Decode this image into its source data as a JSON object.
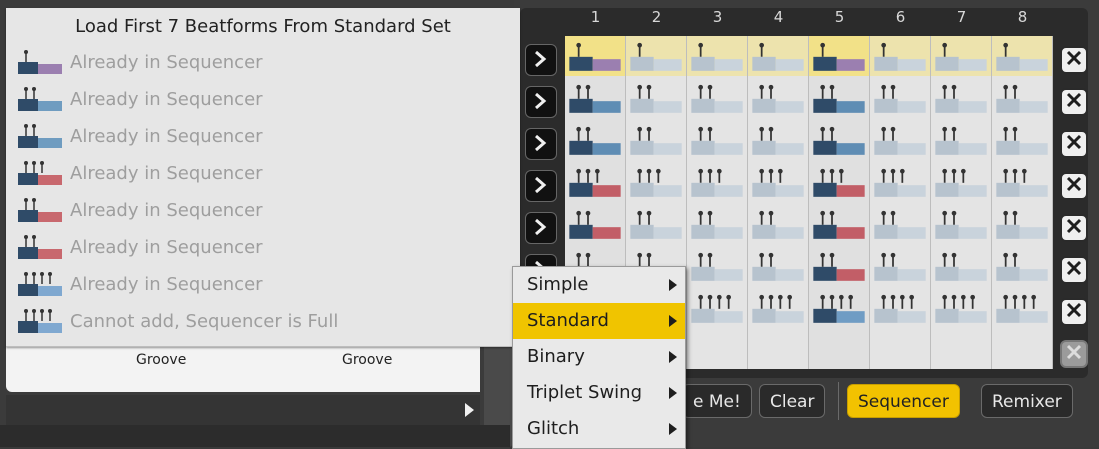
{
  "dropdown": {
    "header": "Load First 7 Beatforms From Standard Set",
    "items": [
      {
        "label": "Already in Sequencer",
        "icon": "beatform-purple-icon",
        "color": "#9b7fb0"
      },
      {
        "label": "Already in Sequencer",
        "icon": "beatform-blue-icon",
        "color": "#6f9cc0"
      },
      {
        "label": "Already in Sequencer",
        "icon": "beatform-blue-icon",
        "color": "#6f9cc0"
      },
      {
        "label": "Already in Sequencer",
        "icon": "beatform-red-icon",
        "color": "#c8686e"
      },
      {
        "label": "Already in Sequencer",
        "icon": "beatform-red-icon",
        "color": "#c8686e"
      },
      {
        "label": "Already in Sequencer",
        "icon": "beatform-red-icon",
        "color": "#c8686e"
      },
      {
        "label": "Already in Sequencer",
        "icon": "beatform-lightblue-icon",
        "color": "#7fa8d0"
      },
      {
        "label": "Cannot add, Sequencer is Full",
        "icon": "beatform-lightblue-icon",
        "color": "#7fa8d0"
      }
    ]
  },
  "panel": {
    "groove_left": "Groove",
    "groove_right": "Groove"
  },
  "sequencer": {
    "columns": [
      "1",
      "2",
      "3",
      "4",
      "5",
      "6",
      "7",
      "8"
    ],
    "active_color": "#f2c200"
  },
  "context_menu": {
    "items": [
      {
        "label": "Simple"
      },
      {
        "label": "Standard"
      },
      {
        "label": "Binary"
      },
      {
        "label": "Triplet Swing"
      },
      {
        "label": "Glitch"
      }
    ]
  },
  "bottom_bar": {
    "make_me": "e Me!",
    "clear": "Clear",
    "sequencer": "Sequencer",
    "remixer": "Remixer"
  }
}
